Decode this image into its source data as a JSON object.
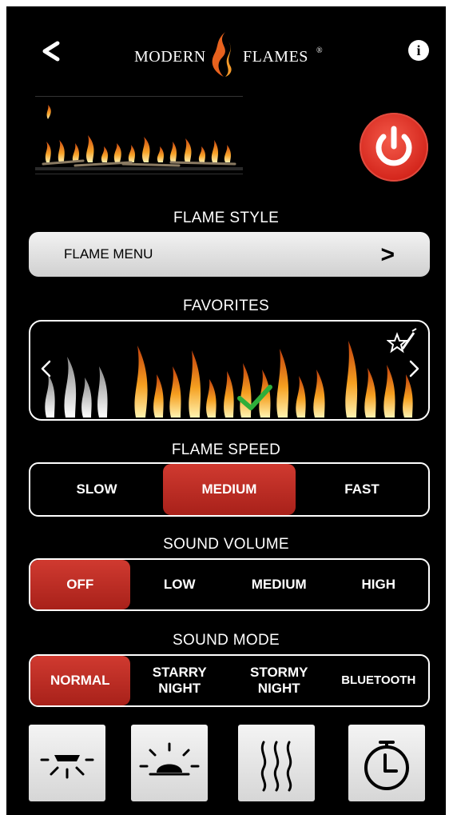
{
  "header": {
    "back_label": "<",
    "brand_left": "MODERN",
    "brand_right": "FLAMES",
    "brand_mark": "®",
    "info_label": "i"
  },
  "flame_style": {
    "title": "FLAME STYLE",
    "menu_label": "FLAME MENU",
    "menu_chevron": ">"
  },
  "favorites": {
    "title": "FAVORITES",
    "prev_label": "<",
    "next_label": ">"
  },
  "flame_speed": {
    "title": "FLAME SPEED",
    "options": [
      "SLOW",
      "MEDIUM",
      "FAST"
    ],
    "selected": "MEDIUM"
  },
  "sound_volume": {
    "title": "SOUND VOLUME",
    "options": [
      "OFF",
      "LOW",
      "MEDIUM",
      "HIGH"
    ],
    "selected": "OFF"
  },
  "sound_mode": {
    "title": "SOUND MODE",
    "options": [
      "NORMAL",
      "STARRY\nNIGHT",
      "STORMY\nNIGHT",
      "BLUETOOTH"
    ],
    "selected": "NORMAL"
  },
  "bottom_controls": [
    "downlight-icon",
    "accent-light-icon",
    "heat-icon",
    "timer-icon"
  ],
  "colors": {
    "accent_red": "#d03a30",
    "power_red": "#e23326",
    "background": "#000000"
  }
}
